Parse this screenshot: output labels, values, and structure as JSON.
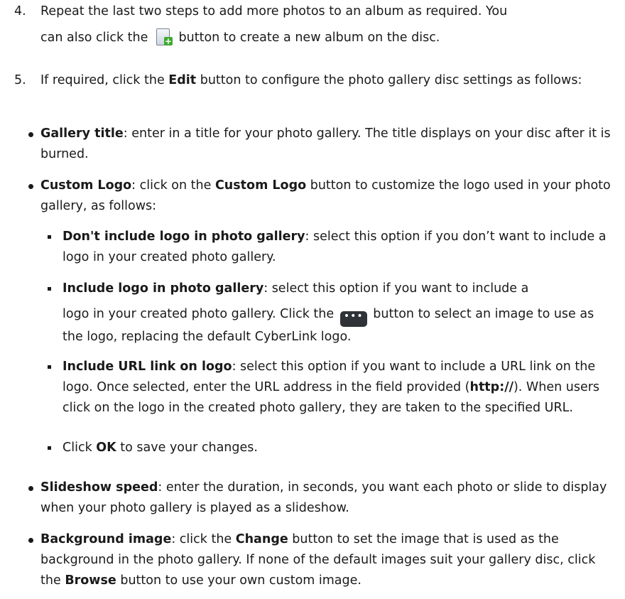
{
  "steps": {
    "s4": {
      "number": "4.",
      "line1": "Repeat the last two steps to add more photos to an album as required. You",
      "line2_pre": "can also click the",
      "line2_post": "button to create a new album on the disc."
    },
    "s5": {
      "number": "5.",
      "pre": "If required, click the",
      "bold": "Edit",
      "post": "button to configure the photo gallery disc settings as follows:"
    }
  },
  "bullets": {
    "gallery_title": {
      "term": "Gallery title",
      "text": ": enter in a title for your photo gallery. The title displays on your disc after it is burned."
    },
    "custom_logo": {
      "term": "Custom Logo",
      "pre": ": click on the",
      "bold": "Custom Logo",
      "post": "button to customize the logo used in your photo gallery, as follows:"
    },
    "slideshow_speed": {
      "term": "Slideshow speed",
      "text": ": enter the duration, in seconds, you want each photo or slide to display when your photo gallery is played as a slideshow."
    },
    "background_image": {
      "term": "Background image",
      "pre": ": click the",
      "bold1": "Change",
      "mid": "button to set the image that is used as the background in the photo gallery. If none of the default images suit your gallery disc, click the",
      "bold2": "Browse",
      "post": "button to use your own custom image."
    }
  },
  "subitems": {
    "dont_include": {
      "term": "Don't include logo in photo gallery",
      "text": ": select this option if you don’t want to include a logo in your created photo gallery."
    },
    "include_logo": {
      "term": "Include logo in photo gallery",
      "line1": ": select this option if you want to include a",
      "pre": "logo in your created photo gallery. Click the",
      "post": "button to select an image to use as the logo, replacing the default CyberLink logo."
    },
    "include_url": {
      "term": "Include URL link on logo",
      "pre": ": select this option if you want to include a URL link on the logo. Once selected, enter the URL address in the field provided (",
      "bold": "http://",
      "post": "). When users click on the logo in the created photo gallery, they are taken to the specified URL."
    },
    "click_ok": {
      "pre": "Click",
      "bold": "OK",
      "post": "to save your changes."
    }
  },
  "icons": {
    "new_album": "new-album-icon",
    "browse_more": "more-dots-icon"
  },
  "icon_glyphs": {
    "plus": "+",
    "dots": "•••"
  }
}
